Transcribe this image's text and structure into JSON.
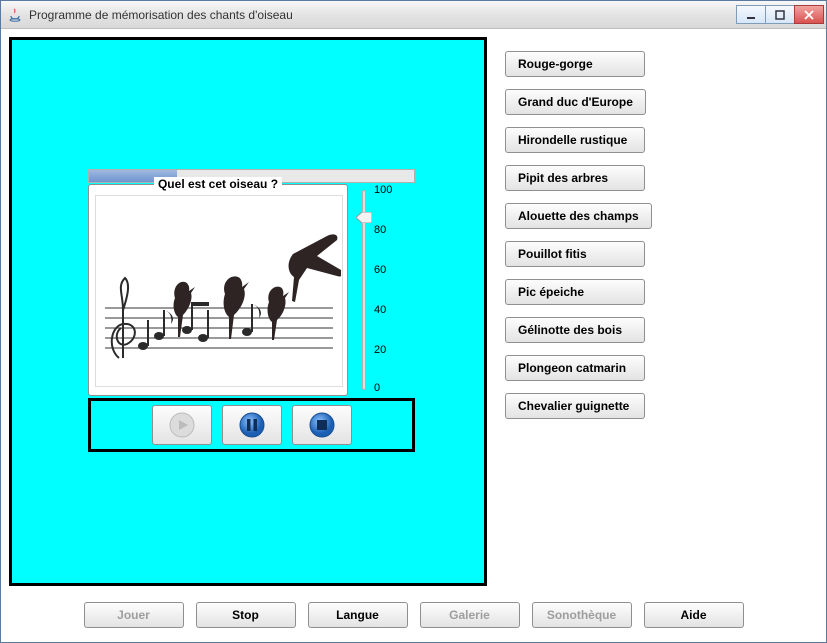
{
  "window": {
    "title": "Programme de mémorisation des chants d'oiseau"
  },
  "quiz": {
    "legend": "Quel est cet oiseau ?",
    "progress_percent": 27,
    "volume_value": 85,
    "volume_ticks": [
      "100",
      "80",
      "60",
      "40",
      "20",
      "0"
    ]
  },
  "birds": [
    "Rouge-gorge",
    "Grand duc d'Europe",
    "Hirondelle rustique",
    "Pipit des arbres",
    "Alouette des champs",
    "Pouillot fitis",
    "Pic épeiche",
    "Gélinotte des bois",
    "Plongeon catmarin",
    "Chevalier guignette"
  ],
  "bottom": {
    "play": "Jouer",
    "stop": "Stop",
    "language": "Langue",
    "gallery": "Galerie",
    "soundlib": "Sonothèque",
    "help": "Aide"
  },
  "icons": {
    "play_disabled": "play-icon",
    "pause": "pause-icon",
    "stop_media": "stop-icon"
  }
}
